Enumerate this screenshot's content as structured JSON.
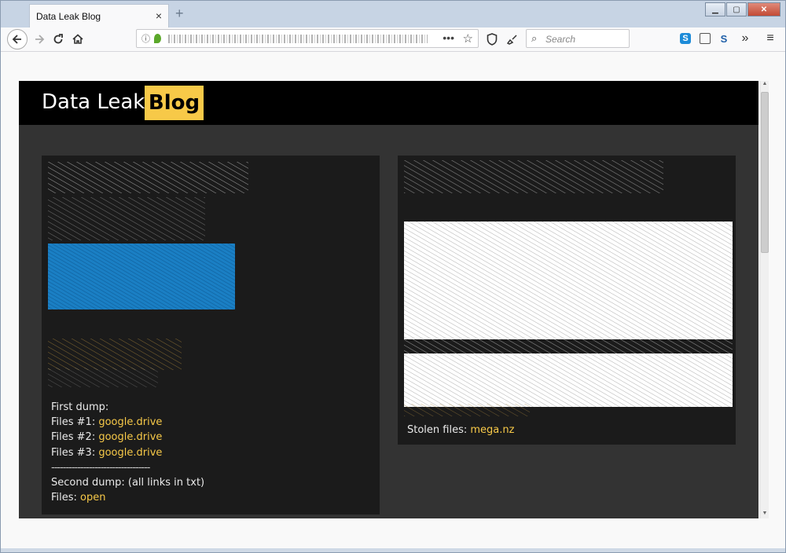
{
  "browser": {
    "tab_title": "Data Leak Blog",
    "tab_close": "×",
    "new_tab": "+",
    "window_buttons": [
      "▁",
      "▢",
      "✕"
    ],
    "url_dots": "•••",
    "search_placeholder": "Search",
    "extensions": [
      "S",
      "▯",
      "S"
    ],
    "overflow": "»",
    "menu": "≡"
  },
  "site": {
    "logo_text": "Data Leak",
    "logo_badge": "Blog"
  },
  "cards": [
    {
      "lines": [
        {
          "label": "First dump:",
          "link": ""
        },
        {
          "label": "Files #1: ",
          "link": "google.drive"
        },
        {
          "label": "Files #2: ",
          "link": "google.drive"
        },
        {
          "label": "Files #3: ",
          "link": "google.drive"
        },
        {
          "label": "----------------------------------",
          "link": ""
        },
        {
          "label": "Second dump: (all links in txt)",
          "link": ""
        },
        {
          "label": "Files: ",
          "link": "open"
        }
      ]
    },
    {
      "lines": [
        {
          "label": "Stolen files: ",
          "link": "mega.nz"
        }
      ]
    }
  ],
  "colors": {
    "accent": "#f7c948",
    "link": "#f7c948",
    "blurred_blue": "#1a7fc4"
  },
  "icons": {
    "back": "back-arrow-icon",
    "forward": "forward-arrow-icon",
    "reload": "reload-icon",
    "home": "home-icon",
    "bookmark": "star-icon",
    "shield": "shield-icon",
    "search": "search-icon"
  }
}
